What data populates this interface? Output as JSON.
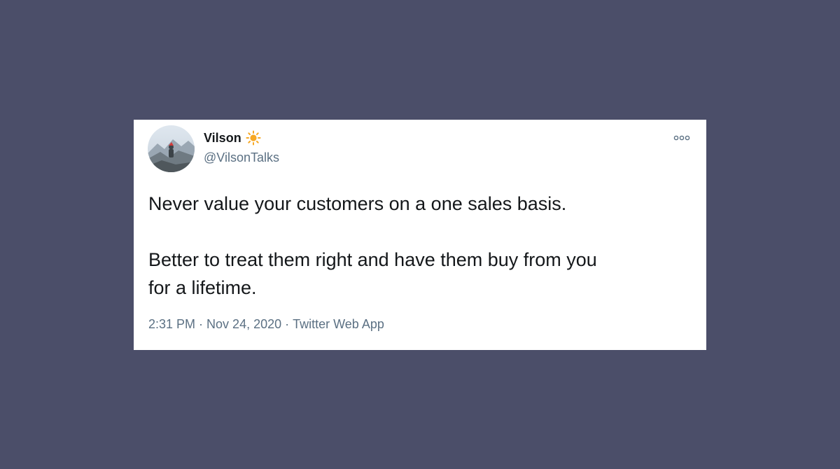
{
  "tweet": {
    "author": {
      "display_name": "Vilson",
      "handle": "@VilsonTalks",
      "name_icon": "sun-icon",
      "avatar_icon": "avatar-mountain-photo"
    },
    "more_icon": "more-options-icon",
    "text": {
      "paragraph_1": "Never value your customers on a one sales basis.",
      "paragraph_2_line_1": "Better to treat them right and have them buy from you",
      "paragraph_2_line_2": "for a lifetime."
    },
    "meta": {
      "time": "2:31 PM",
      "separator": "·",
      "date": "Nov 24, 2020",
      "source": "Twitter Web App"
    }
  },
  "colors": {
    "background": "#4b4e69",
    "card": "#ffffff",
    "text_primary": "#14171a",
    "text_secondary": "#5b7083",
    "sun": "#f7a823"
  }
}
